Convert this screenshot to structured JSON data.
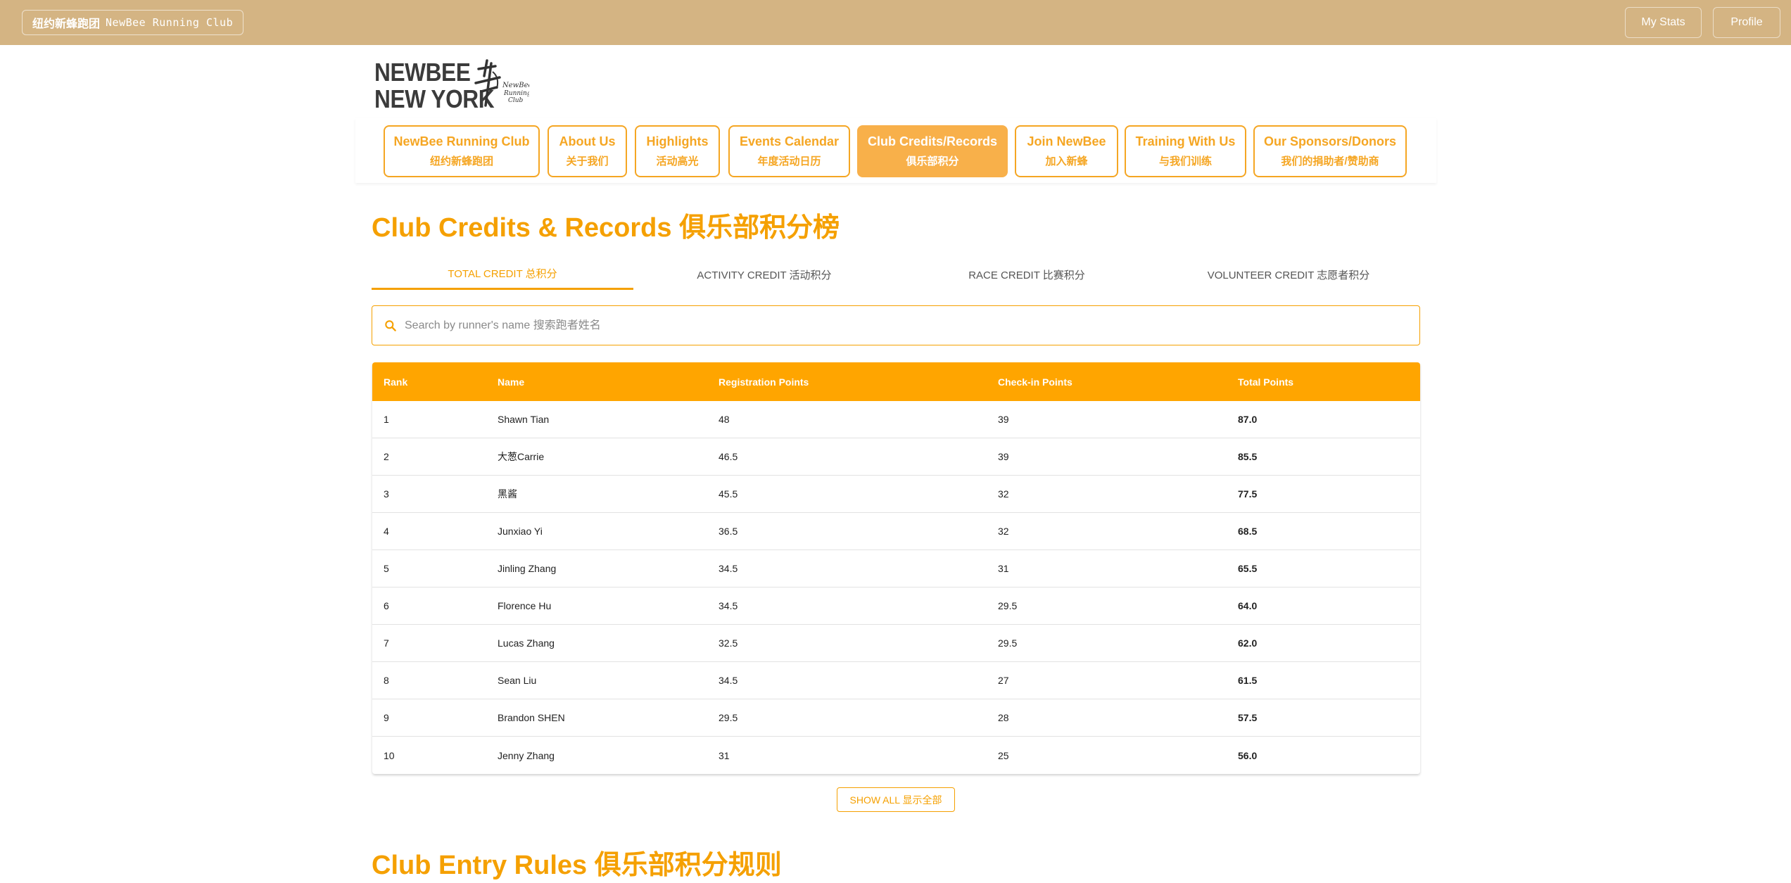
{
  "topbar": {
    "brand_cn": "纽约新蜂跑团",
    "brand_en": "NewBee Running Club",
    "my_stats": "My Stats",
    "profile": "Profile"
  },
  "logo": {
    "line1": "NEWBEE",
    "line2": "NEW YORK"
  },
  "nav": [
    {
      "en": "NewBee Running Club",
      "cn": "纽约新蜂跑团"
    },
    {
      "en": "About Us",
      "cn": "关于我们"
    },
    {
      "en": "Highlights",
      "cn": "活动高光"
    },
    {
      "en": "Events Calendar",
      "cn": "年度活动日历"
    },
    {
      "en": "Club Credits/Records",
      "cn": "俱乐部积分"
    },
    {
      "en": "Join NewBee",
      "cn": "加入新蜂"
    },
    {
      "en": "Training With Us",
      "cn": "与我们训练"
    },
    {
      "en": "Our Sponsors/Donors",
      "cn": "我们的捐助者/赞助商"
    }
  ],
  "page_title": "Club Credits & Records 俱乐部积分榜",
  "tabs": [
    {
      "label": "TOTAL CREDIT 总积分",
      "active": true
    },
    {
      "label": "ACTIVITY CREDIT 活动积分",
      "active": false
    },
    {
      "label": "RACE CREDIT 比赛积分",
      "active": false
    },
    {
      "label": "VOLUNTEER CREDIT 志愿者积分",
      "active": false
    }
  ],
  "search": {
    "placeholder": "Search by runner's name 搜索跑者姓名"
  },
  "table": {
    "headers": [
      "Rank",
      "Name",
      "Registration Points",
      "Check-in Points",
      "Total Points"
    ],
    "rows": [
      [
        "1",
        "Shawn Tian",
        "48",
        "39",
        "87.0"
      ],
      [
        "2",
        "大葱Carrie",
        "46.5",
        "39",
        "85.5"
      ],
      [
        "3",
        "黑酱",
        "45.5",
        "32",
        "77.5"
      ],
      [
        "4",
        "Junxiao Yi",
        "36.5",
        "32",
        "68.5"
      ],
      [
        "5",
        "Jinling Zhang",
        "34.5",
        "31",
        "65.5"
      ],
      [
        "6",
        "Florence Hu",
        "34.5",
        "29.5",
        "64.0"
      ],
      [
        "7",
        "Lucas Zhang",
        "32.5",
        "29.5",
        "62.0"
      ],
      [
        "8",
        "Sean Liu",
        "34.5",
        "27",
        "61.5"
      ],
      [
        "9",
        "Brandon SHEN",
        "29.5",
        "28",
        "57.5"
      ],
      [
        "10",
        "Jenny Zhang",
        "31",
        "25",
        "56.0"
      ]
    ]
  },
  "show_all": "SHOW ALL 显示全部",
  "rules_title": "Club Entry Rules 俱乐部积分规则",
  "colors": {
    "accent": "#f5a000",
    "topbar": "#d4b483",
    "table_header": "#ffa500"
  }
}
